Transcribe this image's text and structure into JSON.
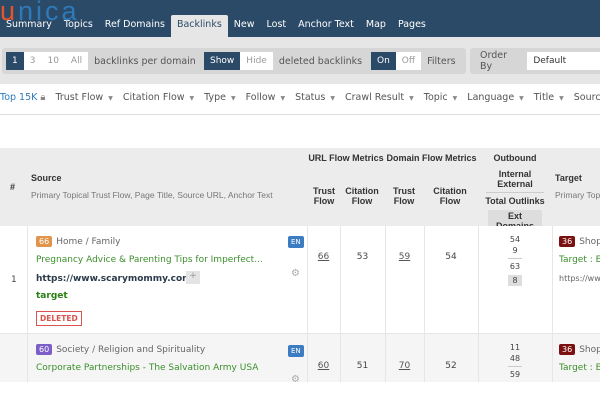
{
  "logo": {
    "text_u": "u",
    "text_rest": "nica"
  },
  "nav": {
    "tabs": [
      "Summary",
      "Topics",
      "Ref Domains",
      "Backlinks",
      "New",
      "Lost",
      "Anchor Text",
      "Map",
      "Pages"
    ],
    "active": "Backlinks"
  },
  "toolbar": {
    "per_domain": {
      "options": [
        "1",
        "3",
        "10",
        "All"
      ],
      "selected": "1",
      "label": "backlinks per domain"
    },
    "deleted": {
      "options": [
        "Show",
        "Hide"
      ],
      "selected": "Show",
      "label": "deleted backlinks"
    },
    "filters": {
      "options": [
        "On",
        "Off"
      ],
      "selected": "On",
      "label": "Filters"
    },
    "order_by": {
      "label": "Order By",
      "value": "Default"
    }
  },
  "filter_bar": {
    "top": "Top 15K",
    "items": [
      "Trust Flow",
      "Citation Flow",
      "Type",
      "Follow",
      "Status",
      "Crawl Result",
      "Topic",
      "Language",
      "Title",
      "Source U"
    ]
  },
  "table": {
    "headers": {
      "num": "#",
      "source": "Source",
      "source_sub": "Primary Topical Trust Flow, Page Title, Source URL, Anchor Text",
      "url_flow": "URL Flow Metrics",
      "domain_flow": "Domain Flow Metrics",
      "outbound": "Outbound",
      "trust_flow": "Trust Flow",
      "citation_flow": "Citation Flow",
      "internal": "Internal",
      "external": "External",
      "total_outlinks": "Total Outlinks",
      "ext_domains": "Ext Domains",
      "target": "Target",
      "target_sub": "Primary Topic"
    },
    "rows": [
      {
        "num": "1",
        "ttf": "66",
        "topic": "Home / Family",
        "topic_color": "#e0954a",
        "title": "Pregnancy Advice & Parenting Tips for Imperfect...",
        "url": "https://www.scarymommy.com/",
        "plus": "+",
        "anchor": "target",
        "lang": "EN",
        "status": "DELETED",
        "url_tf": "66",
        "url_cf": "53",
        "dom_tf": "59",
        "dom_cf": "54",
        "internal": "54",
        "external": "9",
        "total": "63",
        "ext_domains": "8",
        "target_tf": "36",
        "target_topic": "Shopp",
        "target_label": "Target : Ex",
        "target_url": "https://ww"
      },
      {
        "num": "",
        "ttf": "60",
        "topic": "Society / Religion and Spirituality",
        "topic_color": "#7b5ec6",
        "title": "Corporate Partnerships - The Salvation Army USA",
        "lang": "EN",
        "url_tf": "60",
        "url_cf": "51",
        "dom_tf": "70",
        "dom_cf": "52",
        "internal": "11",
        "external": "48",
        "total": "59",
        "target_tf": "36",
        "target_topic": "Shopp",
        "target_label": "Target : Ex"
      }
    ]
  }
}
